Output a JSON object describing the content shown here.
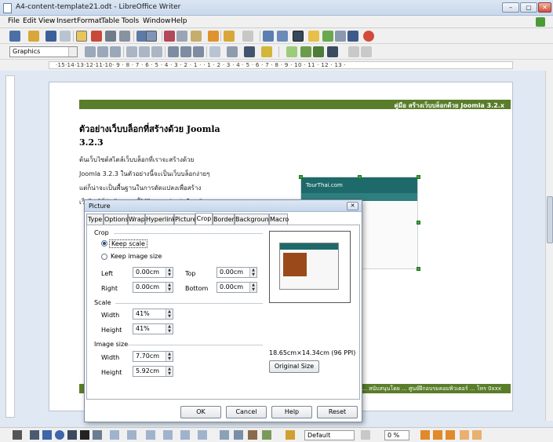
{
  "window": {
    "title": "A4-content-template21.odt - LibreOffice Writer",
    "minimize": "–",
    "maximize": "▢",
    "close": "✕"
  },
  "menu": [
    "File",
    "Edit",
    "View",
    "Insert",
    "Format",
    "Table",
    "Tools",
    "Window",
    "Help"
  ],
  "toolbar": {
    "paragraph_style": "Graphics"
  },
  "ruler": {
    "scale": "·15·14·13·12·11·10· 9 · 8 · 7 · 6 · 5 · 4 · 3 · 2 · 1 ·   · 1 · 2 · 3 · 4 · 5 · 6 · 7 · 8 · 9 · 10 · 11 · 12 · 13 ·"
  },
  "document": {
    "header_text": "คู่มือ สร้างเว็บบล็อกด้วย Joomla 3.2.x",
    "heading_line1": "ตัวอย่างเว็บบล็อกที่สร้างด้วย Joomla",
    "heading_line2": "3.2.3",
    "para_lines": [
      "ต้นเว็บไซต์สไตล์เว็บบล็อกที่เราจะสร้างด้วย",
      "Joomla 3.2.3 ในตัวอย่างนี้จะเป็นเว็บบล็อกง่ายๆ",
      "แต่ก็น่าจะเป็นพื้นฐานในการดัดแปลงเพื่อสร้าง",
      "เว็บไซต์ที่ซับซ้อนกว่านี้ได้ไม่ยาก สำหรับในหน้า"
    ],
    "image_caption": "TourThai.com",
    "footer_text": "ดาวน์โหลดคู่มือนี้ได้ที่ ... สนับสนุนโดย ... ศูนย์ฝึกอบรมคอมพิวเตอร์ ... โทร 0xxx"
  },
  "status": {
    "style": "Default",
    "zoom": "0 %"
  },
  "dialog": {
    "title": "Picture",
    "close": "✕",
    "tabs": [
      "Type",
      "Options",
      "Wrap",
      "Hyperlink",
      "Picture",
      "Crop",
      "Borders",
      "Background",
      "Macro"
    ],
    "active_tab": "Crop",
    "crop": {
      "section": "Crop",
      "keep_scale": "Keep scale",
      "keep_image_size": "Keep image size",
      "left_label": "Left",
      "left_value": "0.00cm",
      "right_label": "Right",
      "right_value": "0.00cm",
      "top_label": "Top",
      "top_value": "0.00cm",
      "bottom_label": "Bottom",
      "bottom_value": "0.00cm"
    },
    "scale": {
      "section": "Scale",
      "width_label": "Width",
      "width_value": "41%",
      "height_label": "Height",
      "height_value": "41%"
    },
    "image_size": {
      "section": "Image size",
      "width_label": "Width",
      "width_value": "7.70cm",
      "height_label": "Height",
      "height_value": "5.92cm"
    },
    "preview_caption": "TourThai.com",
    "original_dims": "18.65cm×14.34cm (96 PPI)",
    "original_size_button": "Original Size",
    "buttons": {
      "ok": "OK",
      "cancel": "Cancel",
      "help": "Help",
      "reset": "Reset"
    }
  },
  "colors": {
    "header_green": "#5a7d2a",
    "image_teal": "#1e6a6a"
  }
}
